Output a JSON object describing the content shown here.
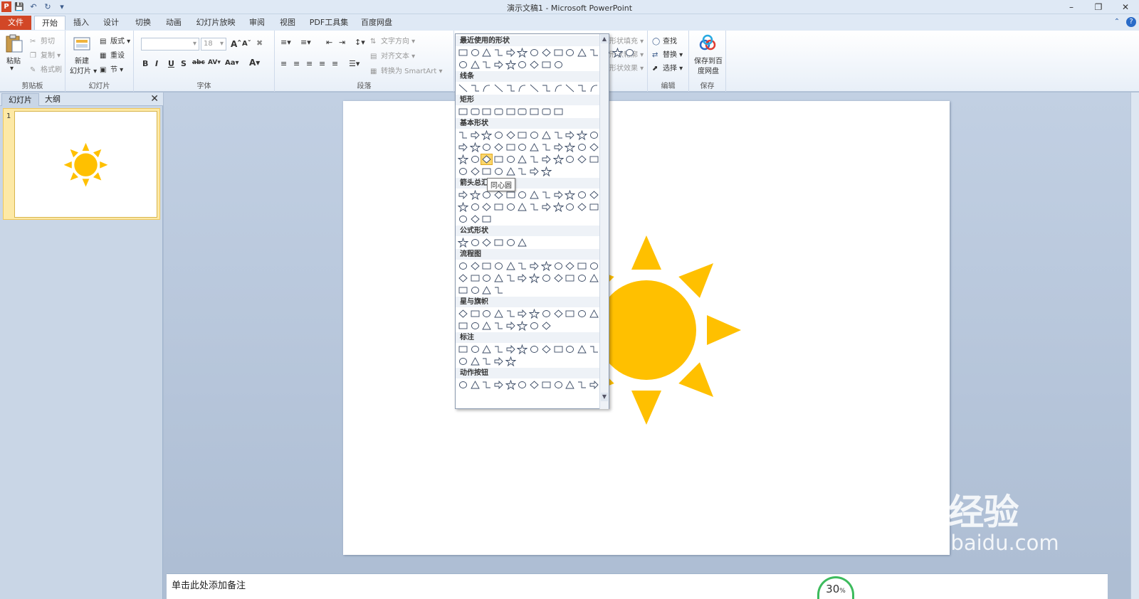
{
  "window": {
    "title": "演示文稿1 - Microsoft PowerPoint",
    "app_icon_letter": "P"
  },
  "tabs": [
    "文件",
    "开始",
    "插入",
    "设计",
    "切换",
    "动画",
    "幻灯片放映",
    "审阅",
    "视图",
    "PDF工具集",
    "百度网盘"
  ],
  "ribbon": {
    "clipboard": {
      "label": "剪贴板",
      "paste": "粘贴",
      "cut": "剪切",
      "copy": "复制",
      "format_painter": "格式刷"
    },
    "slides": {
      "label": "幻灯片",
      "new_slide": "新建",
      "new_slide2": "幻灯片",
      "layout": "版式",
      "reset": "重设",
      "section": "节"
    },
    "font": {
      "label": "字体",
      "size": "18"
    },
    "paragraph": {
      "label": "段落",
      "text_direction": "文字方向",
      "align_text": "对齐文本",
      "smartart": "转换为 SmartArt"
    },
    "drawing": {
      "shape_fill": "形状填充",
      "shape_outline": "形状轮廓",
      "shape_effects": "形状效果"
    },
    "editing": {
      "label": "编辑",
      "find": "查找",
      "replace": "替换",
      "select": "选择"
    },
    "save": {
      "label": "保存",
      "save_to": "保存到百",
      "save_to2": "度网盘"
    }
  },
  "leftpane": {
    "tab_slides": "幻灯片",
    "tab_outline": "大纲",
    "slide_number": "1"
  },
  "shapes_panel": {
    "sections": [
      "最近使用的形状",
      "线条",
      "矩形",
      "基本形状",
      "箭头总汇",
      "公式形状",
      "流程图",
      "星与旗帜",
      "标注",
      "动作按钮"
    ],
    "tooltip": "同心圆"
  },
  "notes_placeholder": "单击此处添加备注",
  "zoom": {
    "value": "30",
    "unit": "%"
  },
  "watermark": {
    "main": "Bai 经验",
    "sub": "jingyan.baidu.com"
  },
  "colors": {
    "sun": "#ffc000",
    "file_tab": "#d24726",
    "accent": "#2a6bc8"
  }
}
